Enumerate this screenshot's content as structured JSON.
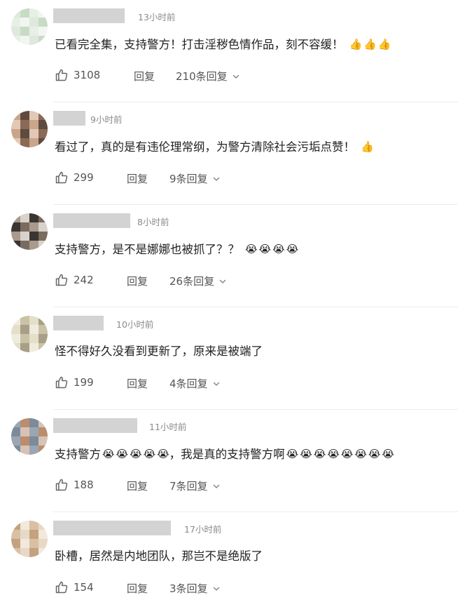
{
  "reply_label": "回复",
  "comments": [
    {
      "time": "13小时前",
      "text": "已看完全集，支持警方！打击淫秽色情作品，刻不容缓！",
      "emojis": [
        "👍",
        "👍",
        "👍"
      ],
      "likes": "3108",
      "replies": "210条回复",
      "avatar_colors": [
        "#dfe8dd",
        "#c8dcc5",
        "#e8efe7",
        "#f2f6f1"
      ]
    },
    {
      "time": "9小时前",
      "text": "看过了，真的是有违伦理常纲，为警方清除社会污垢点赞！",
      "emojis": [
        "👍"
      ],
      "likes": "299",
      "replies": "9条回复",
      "avatar_colors": [
        "#8a6a55",
        "#c9a58a",
        "#5e4a3f",
        "#e2c9b6"
      ]
    },
    {
      "time": "8小时前",
      "text": "支持警方，是不是娜娜也被抓了？？",
      "emojis": [
        "😭",
        "😭",
        "😭",
        "😭"
      ],
      "likes": "242",
      "replies": "26条回复",
      "avatar_colors": [
        "#3a3531",
        "#7a6b60",
        "#a89a8c",
        "#d8d2cb"
      ]
    },
    {
      "time": "10小时前",
      "text": "怪不得好久没看到更新了，原来是被端了",
      "emojis": [],
      "likes": "199",
      "replies": "4条回复",
      "avatar_colors": [
        "#c9c2a6",
        "#e4dfc9",
        "#a79f86",
        "#f0ecdd"
      ]
    },
    {
      "time": "11小时前",
      "text": "支持警方",
      "emojis": [
        "😭",
        "😭",
        "😭",
        "😭",
        "😭"
      ],
      "text2": "，我是真的支持警方啊",
      "emojis2": [
        "😭",
        "😭",
        "😭",
        "😭",
        "😭",
        "😭",
        "😭",
        "😭"
      ],
      "likes": "188",
      "replies": "7条回复",
      "avatar_colors": [
        "#9aa6b3",
        "#b98d6e",
        "#7d8a99",
        "#d6c3b5"
      ]
    },
    {
      "time": "17小时前",
      "text": "卧槽，居然是内地团队，那岂不是绝版了",
      "emojis": [],
      "likes": "154",
      "replies": "3条回复",
      "avatar_colors": [
        "#e8d9c6",
        "#c4a27f",
        "#f2e8dc",
        "#d9c0a3"
      ]
    }
  ]
}
